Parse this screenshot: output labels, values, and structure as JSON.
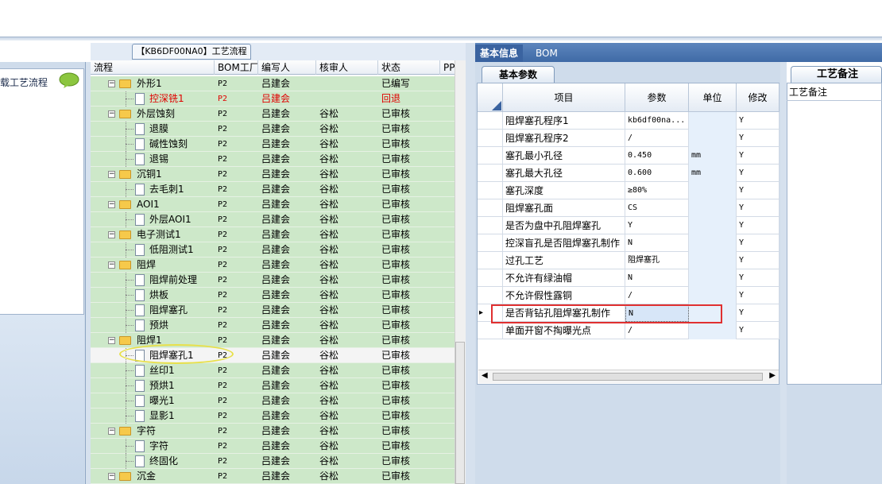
{
  "left_panel": {
    "title": "载工艺流程"
  },
  "center": {
    "title": "【KB6DF00NA0】工艺流程",
    "columns": [
      "流程",
      "BOM工厂",
      "编写人",
      "核审人",
      "状态",
      "PPC"
    ],
    "rows": [
      {
        "level": 0,
        "name": "外形1",
        "bom": "P2",
        "writer": "吕建会",
        "reviewer": "",
        "status": "已编写",
        "red": false
      },
      {
        "level": 1,
        "name": "控深铣1",
        "bom": "P2",
        "writer": "吕建会",
        "reviewer": "",
        "status": "回退",
        "red": true
      },
      {
        "level": 0,
        "name": "外层蚀刻",
        "bom": "P2",
        "writer": "吕建会",
        "reviewer": "谷松",
        "status": "已审核",
        "red": false
      },
      {
        "level": 1,
        "name": "退膜",
        "bom": "P2",
        "writer": "吕建会",
        "reviewer": "谷松",
        "status": "已审核",
        "red": false
      },
      {
        "level": 1,
        "name": "碱性蚀刻",
        "bom": "P2",
        "writer": "吕建会",
        "reviewer": "谷松",
        "status": "已审核",
        "red": false
      },
      {
        "level": 1,
        "name": "退锡",
        "bom": "P2",
        "writer": "吕建会",
        "reviewer": "谷松",
        "status": "已审核",
        "red": false
      },
      {
        "level": 0,
        "name": "沉铜1",
        "bom": "P2",
        "writer": "吕建会",
        "reviewer": "谷松",
        "status": "已审核",
        "red": false
      },
      {
        "level": 1,
        "name": "去毛刺1",
        "bom": "P2",
        "writer": "吕建会",
        "reviewer": "谷松",
        "status": "已审核",
        "red": false
      },
      {
        "level": 0,
        "name": "AOI1",
        "bom": "P2",
        "writer": "吕建会",
        "reviewer": "谷松",
        "status": "已审核",
        "red": false
      },
      {
        "level": 1,
        "name": "外层AOI1",
        "bom": "P2",
        "writer": "吕建会",
        "reviewer": "谷松",
        "status": "已审核",
        "red": false
      },
      {
        "level": 0,
        "name": "电子测试1",
        "bom": "P2",
        "writer": "吕建会",
        "reviewer": "谷松",
        "status": "已审核",
        "red": false
      },
      {
        "level": 1,
        "name": "低阻测试1",
        "bom": "P2",
        "writer": "吕建会",
        "reviewer": "谷松",
        "status": "已审核",
        "red": false
      },
      {
        "level": 0,
        "name": "阻焊",
        "bom": "P2",
        "writer": "吕建会",
        "reviewer": "谷松",
        "status": "已审核",
        "red": false
      },
      {
        "level": 1,
        "name": "阻焊前处理",
        "bom": "P2",
        "writer": "吕建会",
        "reviewer": "谷松",
        "status": "已审核",
        "red": false
      },
      {
        "level": 1,
        "name": "烘板",
        "bom": "P2",
        "writer": "吕建会",
        "reviewer": "谷松",
        "status": "已审核",
        "red": false
      },
      {
        "level": 1,
        "name": "阻焊塞孔",
        "bom": "P2",
        "writer": "吕建会",
        "reviewer": "谷松",
        "status": "已审核",
        "red": false
      },
      {
        "level": 1,
        "name": "预烘",
        "bom": "P2",
        "writer": "吕建会",
        "reviewer": "谷松",
        "status": "已审核",
        "red": false
      },
      {
        "level": 0,
        "name": "阻焊1",
        "bom": "P2",
        "writer": "吕建会",
        "reviewer": "谷松",
        "status": "已审核",
        "red": false
      },
      {
        "level": 1,
        "name": "阻焊塞孔1",
        "bom": "P2",
        "writer": "吕建会",
        "reviewer": "谷松",
        "status": "已审核",
        "red": false,
        "selected": true
      },
      {
        "level": 1,
        "name": "丝印1",
        "bom": "P2",
        "writer": "吕建会",
        "reviewer": "谷松",
        "status": "已审核",
        "red": false
      },
      {
        "level": 1,
        "name": "预烘1",
        "bom": "P2",
        "writer": "吕建会",
        "reviewer": "谷松",
        "status": "已审核",
        "red": false
      },
      {
        "level": 1,
        "name": "曝光1",
        "bom": "P2",
        "writer": "吕建会",
        "reviewer": "谷松",
        "status": "已审核",
        "red": false
      },
      {
        "level": 1,
        "name": "显影1",
        "bom": "P2",
        "writer": "吕建会",
        "reviewer": "谷松",
        "status": "已审核",
        "red": false
      },
      {
        "level": 0,
        "name": "字符",
        "bom": "P2",
        "writer": "吕建会",
        "reviewer": "谷松",
        "status": "已审核",
        "red": false
      },
      {
        "level": 1,
        "name": "字符",
        "bom": "P2",
        "writer": "吕建会",
        "reviewer": "谷松",
        "status": "已审核",
        "red": false
      },
      {
        "level": 1,
        "name": "终固化",
        "bom": "P2",
        "writer": "吕建会",
        "reviewer": "谷松",
        "status": "已审核",
        "red": false
      },
      {
        "level": 0,
        "name": "沉金",
        "bom": "P2",
        "writer": "吕建会",
        "reviewer": "谷松",
        "status": "已审核",
        "red": false
      }
    ]
  },
  "right": {
    "tabs": [
      "基本信息",
      "BOM"
    ],
    "sub_tab": "基本参数",
    "columns": [
      "项目",
      "参数",
      "单位",
      "修改"
    ],
    "rows": [
      {
        "item": "阻焊塞孔程序1",
        "param": "kb6df00na...",
        "unit": "",
        "mod": "Y"
      },
      {
        "item": "阻焊塞孔程序2",
        "param": "/",
        "unit": "",
        "mod": "Y"
      },
      {
        "item": "塞孔最小孔径",
        "param": "0.450",
        "unit": "mm",
        "mod": "Y"
      },
      {
        "item": "塞孔最大孔径",
        "param": "0.600",
        "unit": "mm",
        "mod": "Y"
      },
      {
        "item": "塞孔深度",
        "param": "≥80%",
        "unit": "",
        "mod": "Y"
      },
      {
        "item": "阻焊塞孔面",
        "param": "CS",
        "unit": "",
        "mod": "Y"
      },
      {
        "item": "是否为盘中孔阻焊塞孔",
        "param": "Y",
        "unit": "",
        "mod": "Y"
      },
      {
        "item": "控深盲孔是否阻焊塞孔制作",
        "param": "N",
        "unit": "",
        "mod": "Y"
      },
      {
        "item": "过孔工艺",
        "param": "阻焊塞孔",
        "unit": "",
        "mod": "Y"
      },
      {
        "item": "不允许有绿油帽",
        "param": "N",
        "unit": "",
        "mod": "Y"
      },
      {
        "item": "不允许假性露铜",
        "param": "/",
        "unit": "",
        "mod": "Y"
      },
      {
        "item": "是否背钻孔阻焊塞孔制作",
        "param": "N",
        "unit": "",
        "mod": "Y",
        "current": true
      },
      {
        "item": "单面开窗不掏曝光点",
        "param": "/",
        "unit": "",
        "mod": "Y"
      }
    ],
    "notes_tab": "工艺备注",
    "notes_header": "工艺备注"
  }
}
